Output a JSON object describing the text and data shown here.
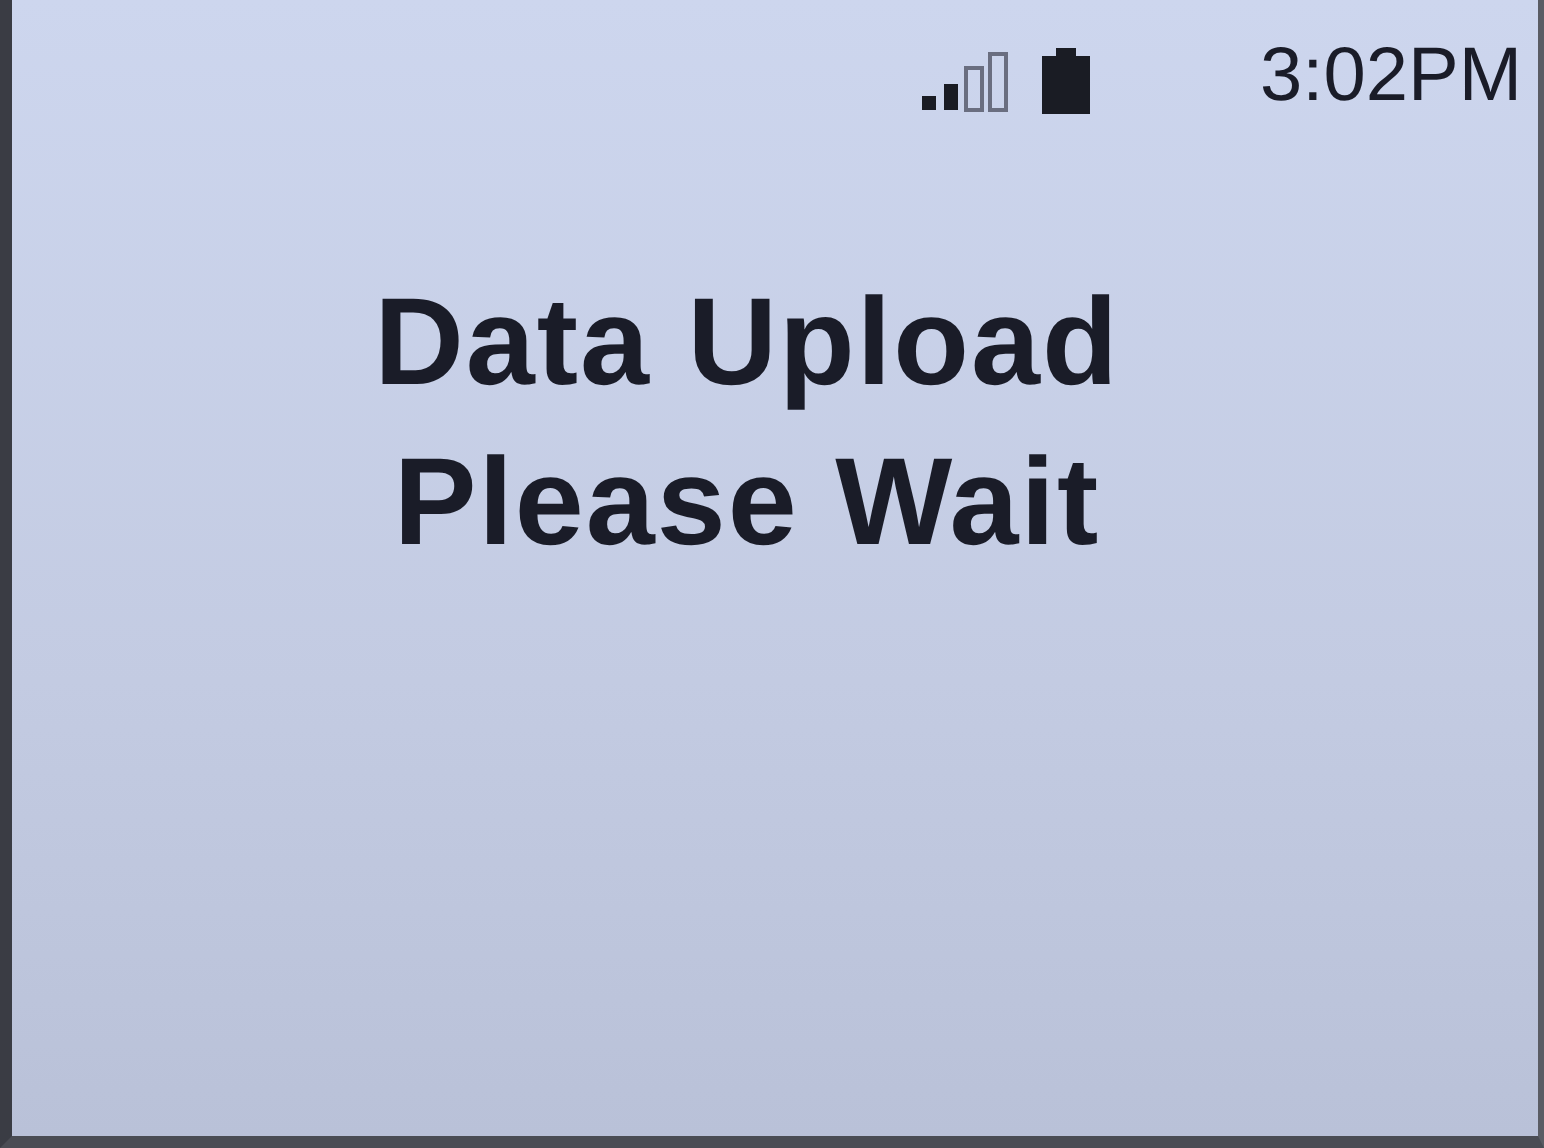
{
  "status_bar": {
    "time": "3:02PM"
  },
  "message": {
    "lines": [
      "Data Upload",
      "Please Wait"
    ]
  }
}
